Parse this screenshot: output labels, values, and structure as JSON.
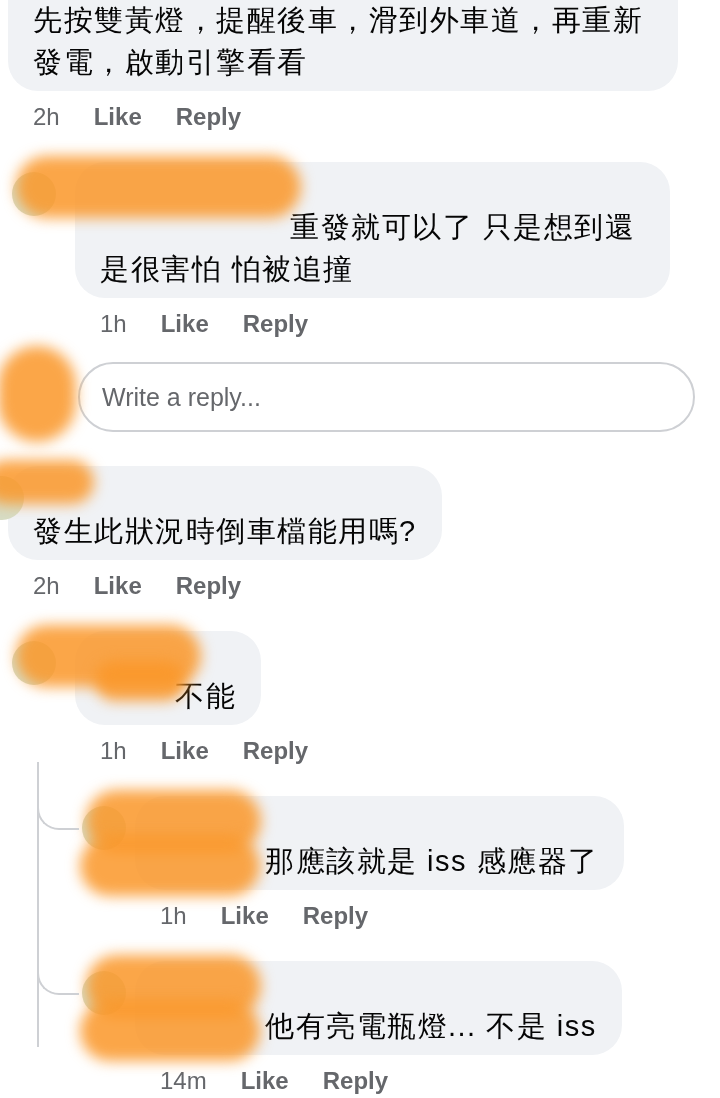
{
  "comments": [
    {
      "text": "先按雙黃燈，提醒後車，滑到外車道，再重新發電，啟動引擎看看",
      "mention": false,
      "cut_top": true,
      "time": "2h",
      "actions": [
        "Like",
        "Reply"
      ],
      "replies": [
        {
          "text": "重發就可以了 只是想到還是很害怕 怕被追撞",
          "mention": true,
          "cut_top": false,
          "time": "1h",
          "actions": [
            "Like",
            "Reply"
          ]
        }
      ],
      "reply_box": {
        "placeholder": "Write a reply..."
      }
    },
    {
      "text": "發生此狀況時倒車檔能用嗎?",
      "mention": false,
      "cut_top": false,
      "time": "2h",
      "actions": [
        "Like",
        "Reply"
      ],
      "replies": [
        {
          "text": "不能",
          "mention": true,
          "cut_top": false,
          "time": "1h",
          "actions": [
            "Like",
            "Reply"
          ],
          "replies": [
            {
              "text": "那應該就是 iss 感應器了",
              "mention": true,
              "cut_top": false,
              "time": "1h",
              "actions": [
                "Like",
                "Reply"
              ]
            },
            {
              "text": "他有亮電瓶燈... 不是 iss",
              "mention": true,
              "cut_top": false,
              "time": "14m",
              "actions": [
                "Like",
                "Reply"
              ]
            }
          ]
        }
      ]
    }
  ]
}
